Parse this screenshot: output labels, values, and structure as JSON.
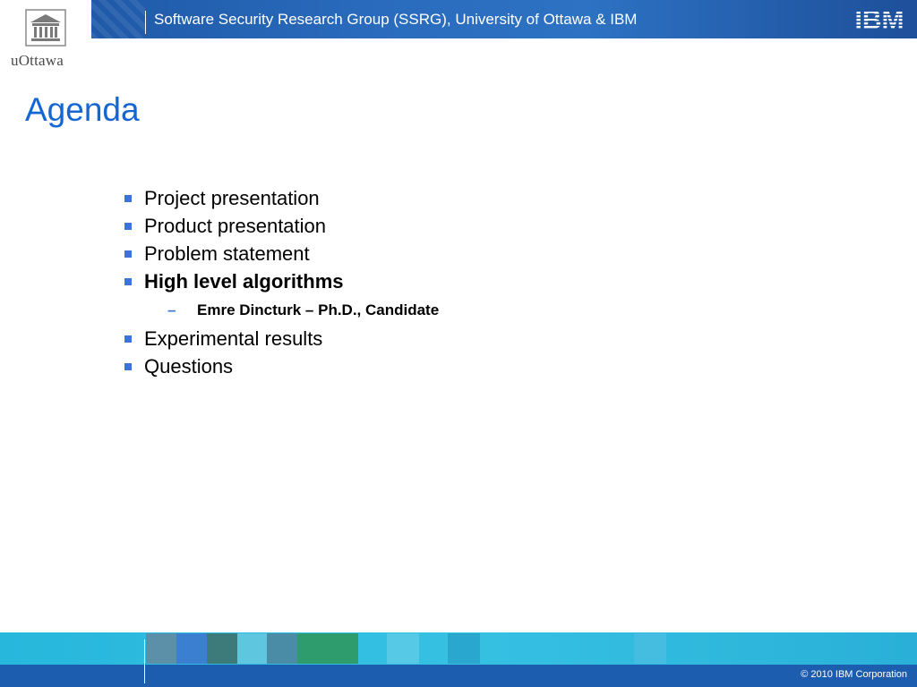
{
  "header": {
    "title": "Software Security Research Group (SSRG), University of Ottawa & IBM",
    "ibm_logo_text": "IBM"
  },
  "logo": {
    "text": "uOttawa",
    "icon": "university-building-icon"
  },
  "slide": {
    "title": "Agenda",
    "items": [
      {
        "label": "Project presentation",
        "style": "normal"
      },
      {
        "label": "Product presentation",
        "style": "normal"
      },
      {
        "label": "Problem statement",
        "style": "normal"
      },
      {
        "label": "High level algorithms",
        "style": "bold"
      },
      {
        "label": "Emre Dincturk – Ph.D., Candidate",
        "style": "sub",
        "marker": "–"
      },
      {
        "label": "Experimental results",
        "style": "normal"
      },
      {
        "label": "Questions",
        "style": "normal"
      }
    ]
  },
  "footer": {
    "copyright": "© 2010 IBM Corporation"
  },
  "colors": {
    "title": "#1565d3",
    "bullet": "#3a74d9",
    "header": "#2a6bbd",
    "footer_strip": "#36c1e3",
    "footer_bottom": "#1d5db0"
  }
}
